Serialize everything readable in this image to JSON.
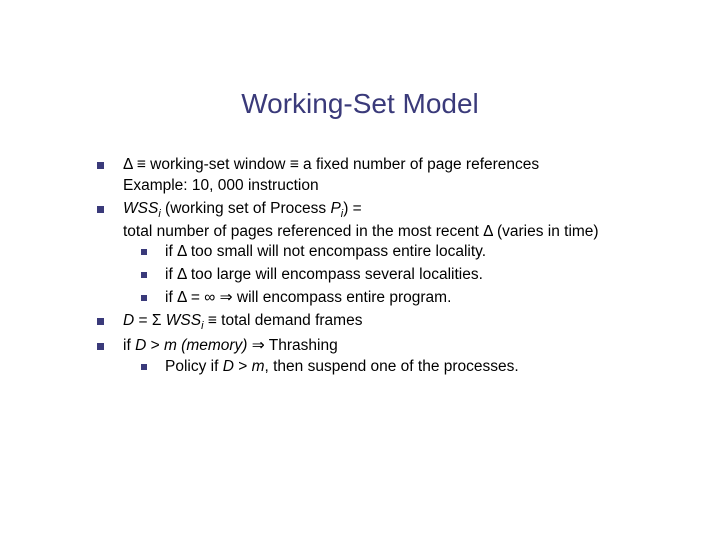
{
  "title": "Working-Set Model",
  "b1": {
    "p1": "Δ ≡ working-set window ≡ a fixed number of page references",
    "p2": "Example:  10, 000 instruction"
  },
  "b2": {
    "wss": "WSS",
    "i1": "i",
    "mid1": " (working set of Process ",
    "P": "P",
    "i2": "i",
    "mid2": ") = ",
    "line2": "total number of pages referenced in the most recent Δ (varies in time)",
    "s1": "if Δ too small will not encompass entire locality.",
    "s2": "if Δ too large will encompass several localities.",
    "s3": "if Δ = ∞ ⇒ will encompass entire program."
  },
  "b3": {
    "D": "D",
    "eq": " = Σ ",
    "wss": "WSS",
    "i": "i",
    "tail": " ≡ total demand frames"
  },
  "b4": {
    "pre": "if ",
    "D": "D",
    "gt": " > ",
    "m": "m (memory)",
    "arrow": " ⇒ Thrashing",
    "policy_pre": "Policy if ",
    "policy_D": "D",
    "policy_gt": " > ",
    "policy_m": "m",
    "policy_tail": ", then suspend one of the processes."
  }
}
